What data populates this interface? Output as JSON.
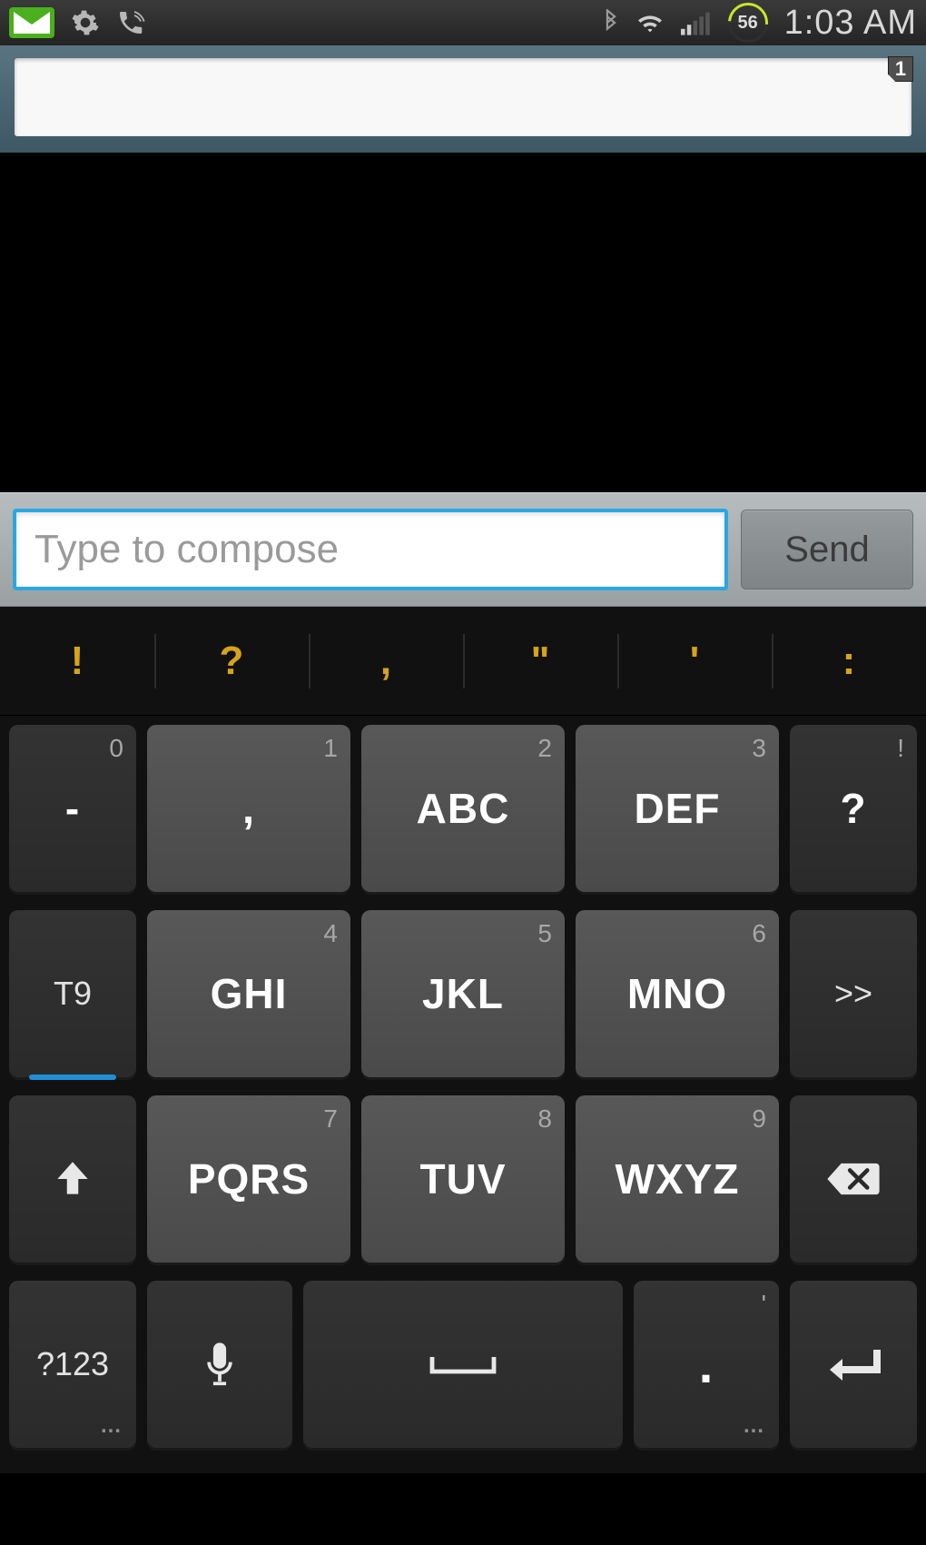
{
  "status": {
    "battery": "56",
    "time": "1:03 AM"
  },
  "recipient": {
    "badge": "1"
  },
  "compose": {
    "placeholder": "Type to compose",
    "send": "Send"
  },
  "suggestions": [
    "!",
    "?",
    ",",
    "\"",
    "'",
    ":"
  ],
  "keys": {
    "r1": [
      {
        "sup": "0",
        "main": "-"
      },
      {
        "sup": "1",
        "main": ","
      },
      {
        "sup": "2",
        "main": "ABC"
      },
      {
        "sup": "3",
        "main": "DEF"
      },
      {
        "sup": "!",
        "main": "?"
      }
    ],
    "r2_side_left": "T9",
    "r2": [
      {
        "sup": "4",
        "main": "GHI"
      },
      {
        "sup": "5",
        "main": "JKL"
      },
      {
        "sup": "6",
        "main": "MNO"
      }
    ],
    "r2_side_right": ">>",
    "r3": [
      {
        "sup": "7",
        "main": "PQRS"
      },
      {
        "sup": "8",
        "main": "TUV"
      },
      {
        "sup": "9",
        "main": "WXYZ"
      }
    ],
    "r4": {
      "sym": "?123",
      "period_sup": "'",
      "period": "."
    }
  }
}
